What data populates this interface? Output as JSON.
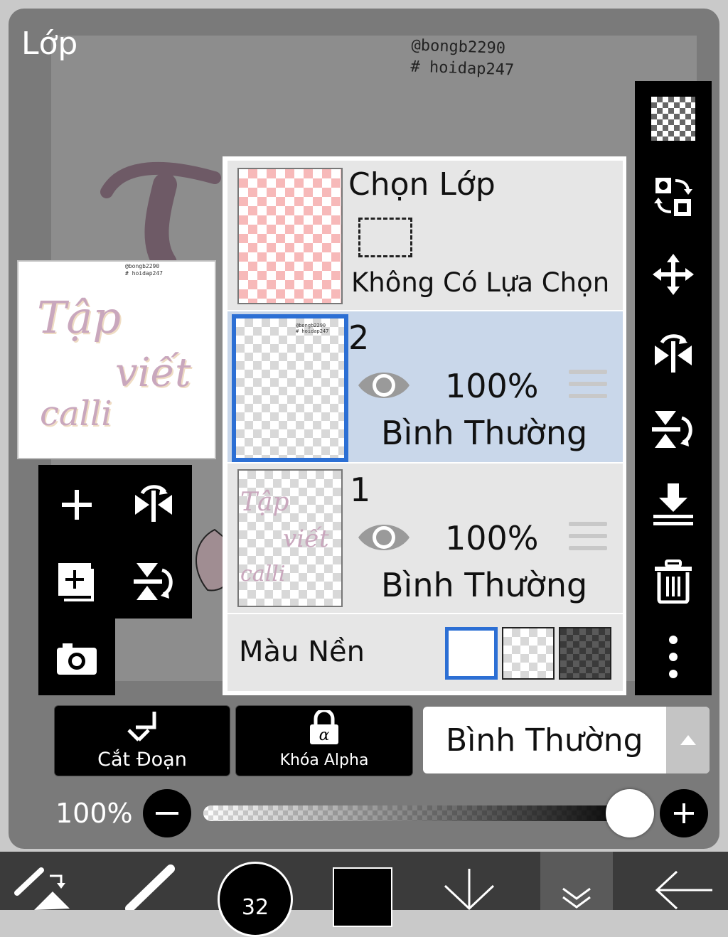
{
  "panel": {
    "title": "Lớp"
  },
  "canvas": {
    "watermark_line1": "@bongb2290",
    "watermark_line2": "# hoidap247",
    "artwork_text": [
      "Tập",
      "viết",
      "calli"
    ]
  },
  "preview": {
    "watermark_line1": "@bongb2290",
    "watermark_line2": "# hoidap247"
  },
  "selection_layer": {
    "title": "Chọn Lớp",
    "status": "Không Có Lựa Chọn"
  },
  "layers": [
    {
      "number": "2",
      "opacity": "100%",
      "blend": "Bình Thường",
      "selected": true
    },
    {
      "number": "1",
      "opacity": "100%",
      "blend": "Bình Thường",
      "selected": false
    }
  ],
  "background_color": {
    "label": "Màu Nền",
    "options": [
      "white",
      "transparent",
      "dark"
    ],
    "selected": "white"
  },
  "actions": {
    "clip_label": "Cắt Đoạn",
    "alpha_lock_label": "Khóa Alpha",
    "blend_mode_value": "Bình Thường"
  },
  "opacity_slider": {
    "value_label": "100%",
    "value": 1.0
  },
  "bottom_toolbar": {
    "brush_size": "32"
  },
  "colors": {
    "selected_layer_bg": "#c9d7ea",
    "selection_accent": "#2c6fd4",
    "toolbar_black": "#000000",
    "panel_gray": "#7a7a7a",
    "layer_panel_bg": "#e6e6e6"
  }
}
